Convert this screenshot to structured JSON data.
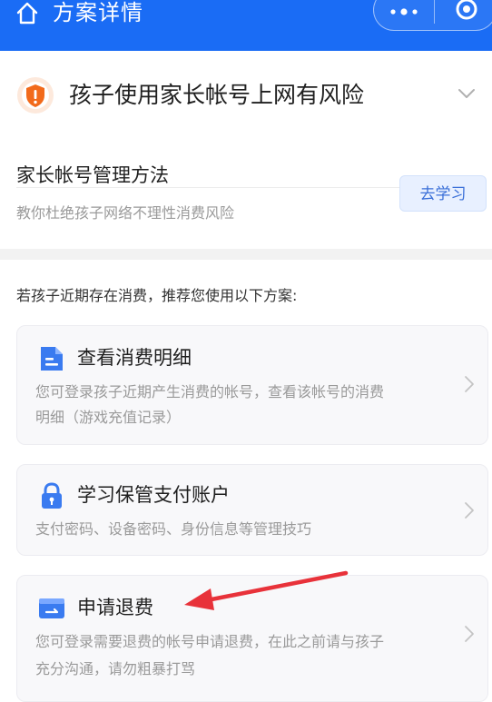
{
  "header": {
    "title": "方案详情",
    "home_icon": "home-icon",
    "more_icon": "more-dots-icon",
    "target_icon": "target-icon",
    "bg_color": "#1a6cf5"
  },
  "risk": {
    "title": "孩子使用家长帐号上网有风险",
    "icon": "shield-alert-icon",
    "icon_color": "#f26a1b"
  },
  "method": {
    "title": "家长帐号管理方法",
    "subtitle": "教你杜绝孩子网络不理性消费风险",
    "button_label": "去学习"
  },
  "recommend_text": "若孩子近期存在消费，推荐您使用以下方案:",
  "options": [
    {
      "title": "查看消费明细",
      "desc_line1": "您可登录孩子近期产生消费的帐号，查看该帐号的消费",
      "desc_line2": "明细（游戏充值记录）",
      "icon": "document-icon"
    },
    {
      "title": "学习保管支付账户",
      "desc_line1": "支付密码、设备密码、身份信息等管理技巧",
      "icon": "lock-icon"
    },
    {
      "title": "申请退费",
      "desc_line1": "您可登录需要退费的帐号申请退费，在此之前请与孩子",
      "desc_line2": "充分沟通，请勿粗暴打骂",
      "icon": "refund-card-icon"
    }
  ],
  "annotation": {
    "arrow_color": "#e8323a",
    "points_to": "申请退费"
  },
  "colors": {
    "accent": "#1a6cf5",
    "icon_blue": "#3a7bf0",
    "muted_text": "#9a9a9a"
  }
}
